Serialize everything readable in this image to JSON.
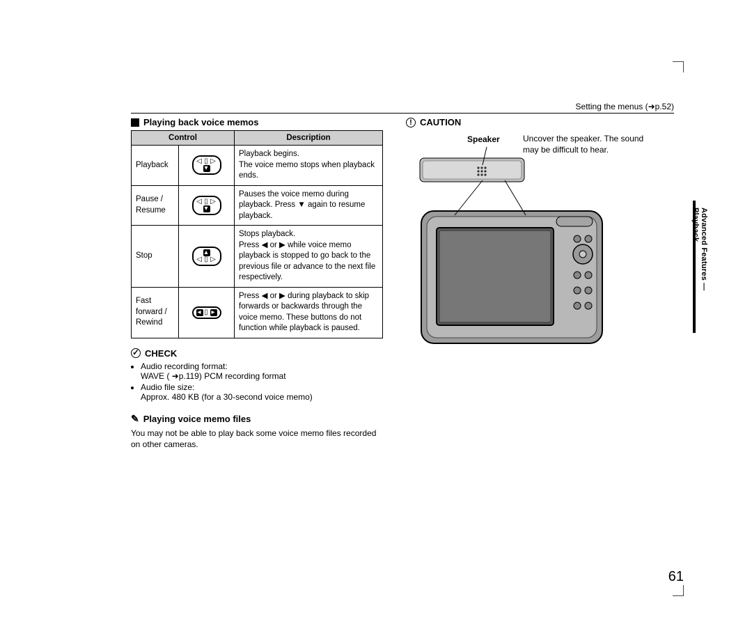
{
  "header": {
    "right_label": "Setting the menus (➜p.52)"
  },
  "left": {
    "title": "Playing back voice memos",
    "table": {
      "cols": [
        "Control",
        "Description"
      ],
      "rows": [
        {
          "name": "Playback",
          "desc": "Playback begins.\nThe voice memo stops when playback ends."
        },
        {
          "name": "Pause / Resume",
          "desc": "Pauses the voice memo during playback. Press ▼ again to resume playback."
        },
        {
          "name": "Stop",
          "desc": "Stops playback.\nPress ◀ or ▶ while voice memo playback is stopped to go back to the previous file or advance to the next file respectively."
        },
        {
          "name": "Fast forward / Rewind",
          "desc": "Press ◀ or ▶ during playback to skip forwards or backwards through the voice memo. These buttons do not function while playback is paused."
        }
      ]
    },
    "check": {
      "title": "CHECK",
      "items": [
        "Audio recording format:\nWAVE ( ➜p.119) PCM recording format",
        "Audio file size:\nApprox. 480 KB (for a 30-second voice memo)"
      ]
    },
    "files": {
      "title": "Playing voice memo files",
      "text": "You may not be able to play back some voice memo files recorded on other cameras."
    }
  },
  "right": {
    "caution_title": "CAUTION",
    "speaker_label": "Speaker",
    "caution_text": "Uncover the speaker. The sound may be difficult to hear."
  },
  "side_tab": "Advanced Features — Playback",
  "page_number": "61"
}
